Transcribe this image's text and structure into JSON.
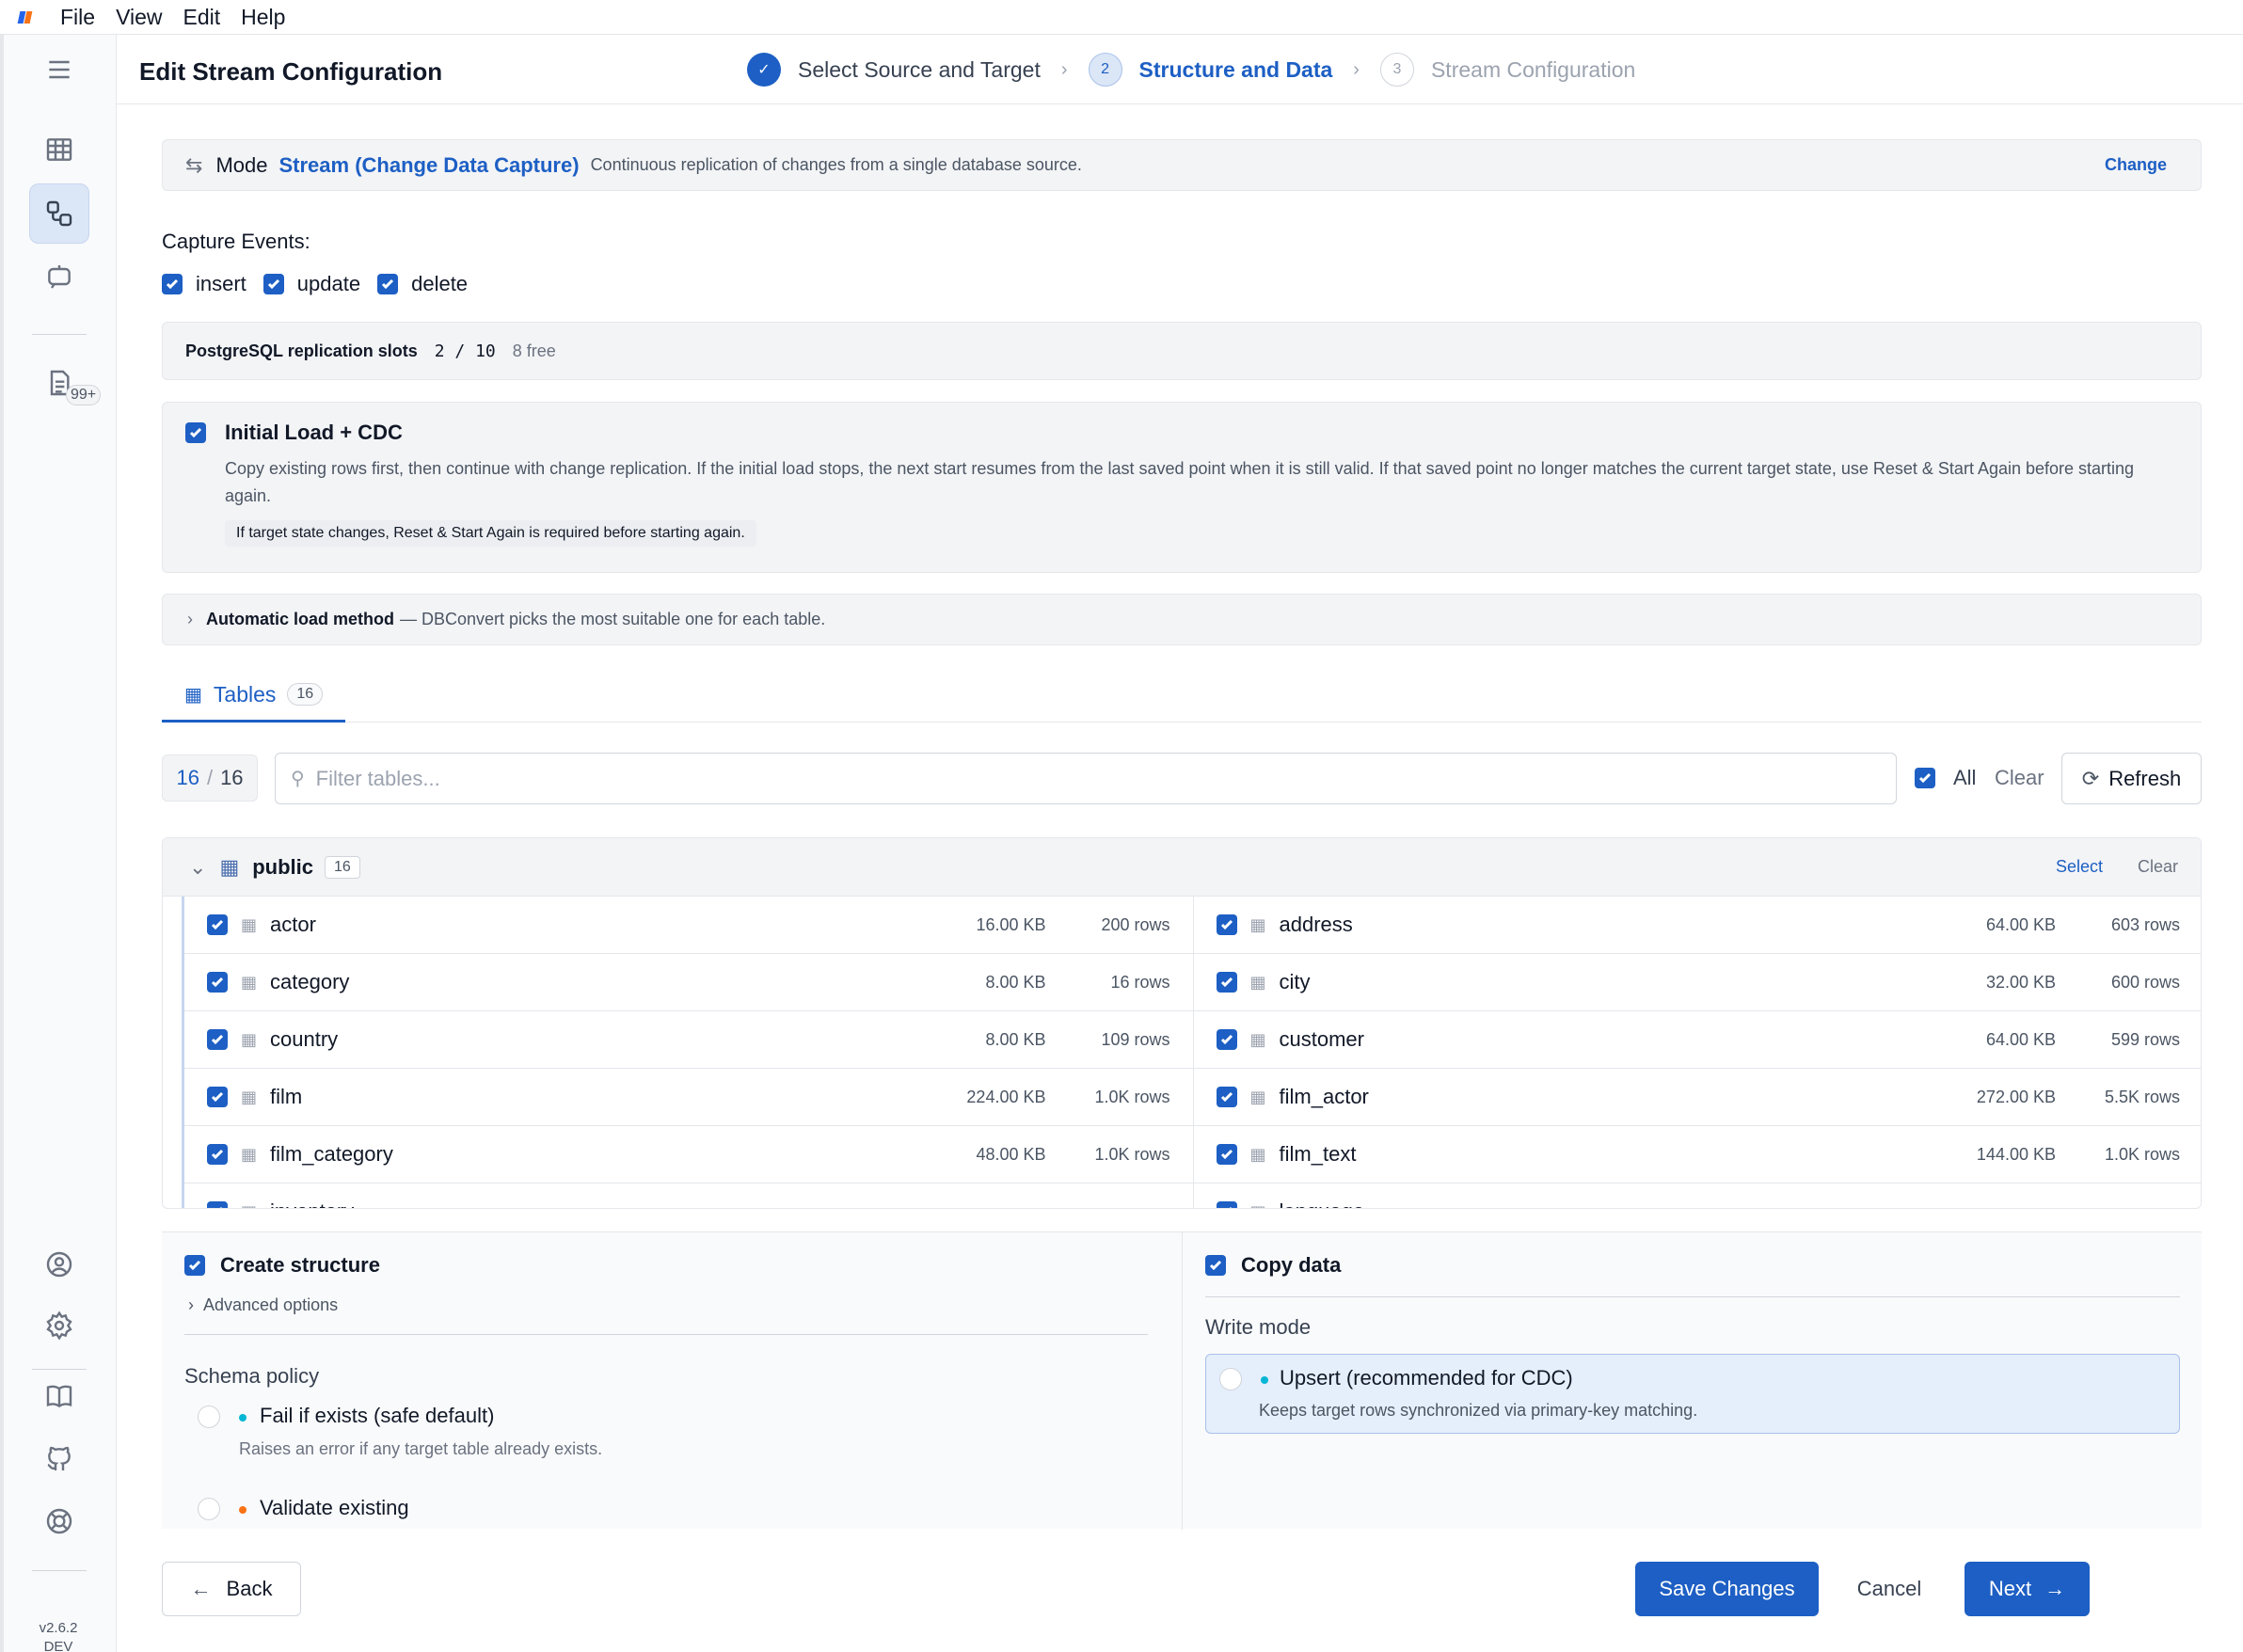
{
  "menubar": {
    "items": [
      "File",
      "View",
      "Edit",
      "Help"
    ]
  },
  "sidebar": {
    "badge": "99+",
    "version": "v2.6.2",
    "build": "DEV",
    "icons": [
      "menu-icon",
      "table-icon",
      "streams-icon",
      "chat-bot-icon",
      "logs-icon",
      "account-icon",
      "gear-icon",
      "docs-book-icon",
      "github-icon",
      "help-lifebuoy-icon"
    ]
  },
  "header": {
    "title": "Edit Stream Configuration",
    "steps": [
      {
        "number": "1",
        "label": "Select Source and Target",
        "state": "done"
      },
      {
        "number": "2",
        "label": "Structure and Data",
        "state": "current"
      },
      {
        "number": "3",
        "label": "Stream Configuration",
        "state": "todo"
      }
    ]
  },
  "mode": {
    "label": "Mode",
    "value": "Stream (Change Data Capture)",
    "description": "Continuous replication of changes from a single database source.",
    "change_label": "Change"
  },
  "capture": {
    "title": "Capture Events:",
    "events": [
      {
        "label": "insert",
        "checked": true
      },
      {
        "label": "update",
        "checked": true
      },
      {
        "label": "delete",
        "checked": true
      }
    ]
  },
  "slots": {
    "title": "PostgreSQL replication slots",
    "used": "2 / 10",
    "free": "8 free"
  },
  "initial_load": {
    "checked": true,
    "title": "Initial Load + CDC",
    "description": "Copy existing rows first, then continue with change replication. If the initial load stops, the next start resumes from the last saved point when it is still valid. If that saved point no longer matches the current target state, use Reset & Start Again before starting again.",
    "note": "If target state changes, Reset & Start Again is required before starting again."
  },
  "auto_load": {
    "title": "Automatic load method",
    "description": "— DBConvert picks the most suitable one for each table."
  },
  "tabs": {
    "tables_label": "Tables",
    "tables_count": "16"
  },
  "filter": {
    "selected": "16",
    "total": "16",
    "placeholder": "Filter tables...",
    "all_label": "All",
    "clear_label": "Clear",
    "refresh_label": "Refresh"
  },
  "schema": {
    "name": "public",
    "count": "16",
    "select_label": "Select",
    "clear_label": "Clear",
    "tables": [
      {
        "name": "actor",
        "size": "16.00 KB",
        "rows": "200 rows"
      },
      {
        "name": "address",
        "size": "64.00 KB",
        "rows": "603 rows"
      },
      {
        "name": "category",
        "size": "8.00 KB",
        "rows": "16 rows"
      },
      {
        "name": "city",
        "size": "32.00 KB",
        "rows": "600 rows"
      },
      {
        "name": "country",
        "size": "8.00 KB",
        "rows": "109 rows"
      },
      {
        "name": "customer",
        "size": "64.00 KB",
        "rows": "599 rows"
      },
      {
        "name": "film",
        "size": "224.00 KB",
        "rows": "1.0K rows"
      },
      {
        "name": "film_actor",
        "size": "272.00 KB",
        "rows": "5.5K rows"
      },
      {
        "name": "film_category",
        "size": "48.00 KB",
        "rows": "1.0K rows"
      },
      {
        "name": "film_text",
        "size": "144.00 KB",
        "rows": "1.0K rows"
      },
      {
        "name": "inventory",
        "size": "",
        "rows": ""
      },
      {
        "name": "language",
        "size": "",
        "rows": ""
      }
    ]
  },
  "structure": {
    "checked": true,
    "title": "Create structure",
    "advanced_label": "Advanced options",
    "policy_title": "Schema policy",
    "policies": [
      {
        "title": "Fail if exists (safe default)",
        "description": "Raises an error if any target table already exists.",
        "dot_color": "#06b6d4"
      },
      {
        "title": "Validate existing",
        "description": "",
        "dot_color": "#f97316"
      }
    ]
  },
  "copy_data": {
    "checked": true,
    "title": "Copy data",
    "write_mode_title": "Write mode",
    "option_title": "Upsert (recommended for CDC)",
    "option_description": "Keeps target rows synchronized via primary-key matching.",
    "dot_color": "#06b6d4"
  },
  "footer": {
    "back_label": "Back",
    "save_label": "Save Changes",
    "cancel_label": "Cancel",
    "next_label": "Next"
  }
}
